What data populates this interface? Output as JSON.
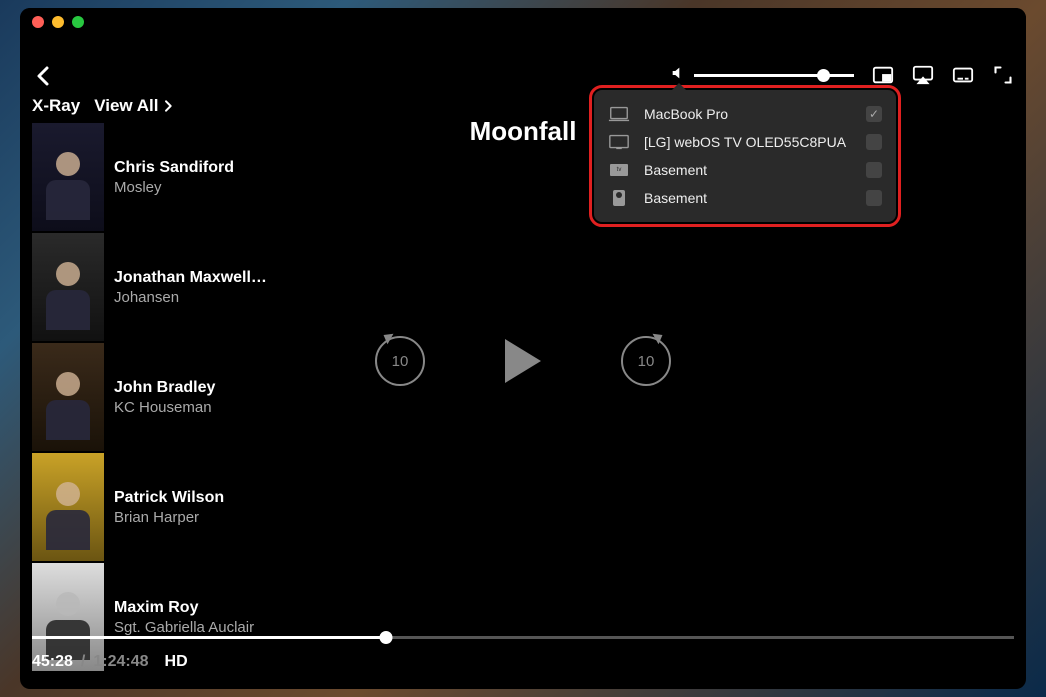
{
  "title": "Moonfall",
  "xray": {
    "label": "X-Ray",
    "view_all": "View All"
  },
  "cast": [
    {
      "actor": "Chris Sandiford",
      "role": "Mosley"
    },
    {
      "actor": "Jonathan Maxwell…",
      "role": "Johansen"
    },
    {
      "actor": "John Bradley",
      "role": "KC Houseman"
    },
    {
      "actor": "Patrick Wilson",
      "role": "Brian Harper"
    },
    {
      "actor": "Maxim Roy",
      "role": "Sgt. Gabriella Auclair"
    }
  ],
  "skip_seconds": "10",
  "airplay": {
    "devices": [
      {
        "icon": "laptop",
        "name": "MacBook Pro",
        "selected": true
      },
      {
        "icon": "tv",
        "name": "[LG] webOS TV OLED55C8PUA",
        "selected": false
      },
      {
        "icon": "appletv",
        "name": "Basement",
        "selected": false
      },
      {
        "icon": "speaker",
        "name": "Basement",
        "selected": false
      }
    ]
  },
  "time": {
    "current": "45:28",
    "total": "1:24:48",
    "quality": "HD"
  }
}
